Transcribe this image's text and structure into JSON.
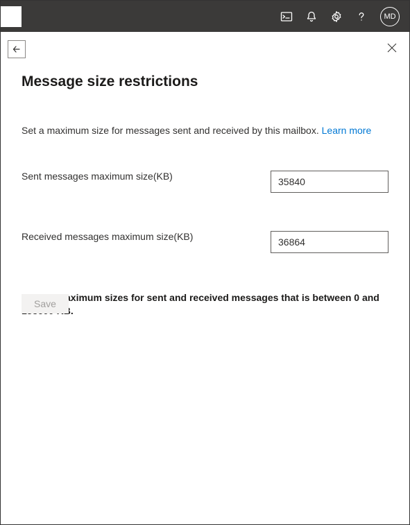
{
  "topbar": {
    "avatar_initials": "MD"
  },
  "panel": {
    "title": "Message size restrictions",
    "intro_text": "Set a maximum size for messages sent and received by this mailbox. ",
    "learn_more_label": "Learn more",
    "sent_label": "Sent messages maximum size(KB)",
    "sent_value": "35840",
    "received_label": "Received messages maximum size(KB)",
    "received_value": "36864",
    "constraint_text": "Set the maximum sizes for sent and received messages that is between 0 and 153600 KB.",
    "save_label": "Save"
  }
}
